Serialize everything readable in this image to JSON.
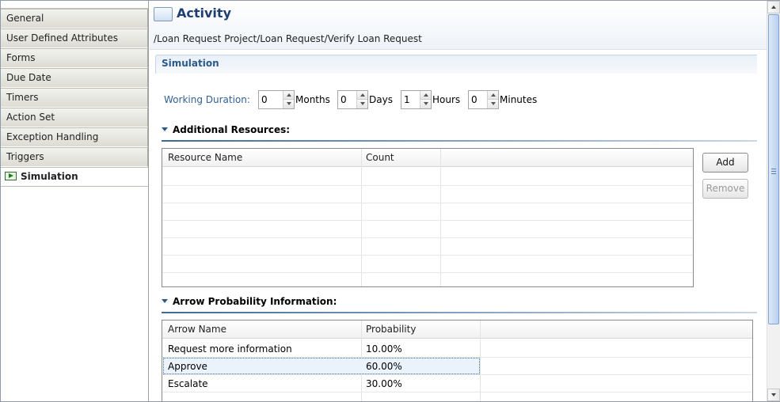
{
  "sidebar": {
    "tabs": [
      {
        "label": "General"
      },
      {
        "label": "User Defined Attributes"
      },
      {
        "label": "Forms"
      },
      {
        "label": "Due Date"
      },
      {
        "label": "Timers"
      },
      {
        "label": "Action Set"
      },
      {
        "label": "Exception Handling"
      },
      {
        "label": "Triggers"
      },
      {
        "label": "Simulation",
        "active": true,
        "icon": "simulation-play-icon"
      }
    ]
  },
  "header": {
    "title": "Activity",
    "icon": "activity-icon",
    "path": "/Loan Request Project/Loan Request/Verify Loan Request"
  },
  "section": {
    "title": "Simulation"
  },
  "working_duration": {
    "label": "Working Duration:",
    "months": {
      "value": "0",
      "unit": "Months"
    },
    "days": {
      "value": "0",
      "unit": "Days"
    },
    "hours": {
      "value": "1",
      "unit": "Hours"
    },
    "minutes": {
      "value": "0",
      "unit": "Minutes"
    }
  },
  "additional_resources": {
    "title": "Additional Resources:",
    "columns": [
      "Resource Name",
      "Count"
    ],
    "rows": [],
    "add_label": "Add",
    "remove_label": "Remove"
  },
  "arrow_probability": {
    "title": "Arrow Probability Information:",
    "columns": [
      "Arrow Name",
      "Probability"
    ],
    "rows": [
      {
        "name": "Request more information",
        "probability": "10.00%"
      },
      {
        "name": "Approve",
        "probability": "60.00%",
        "selected": true
      },
      {
        "name": "Escalate",
        "probability": "30.00%"
      }
    ]
  },
  "colors": {
    "accent": "#2a5a8a",
    "title": "#1f3f73",
    "label_blue": "#2f5f93"
  }
}
